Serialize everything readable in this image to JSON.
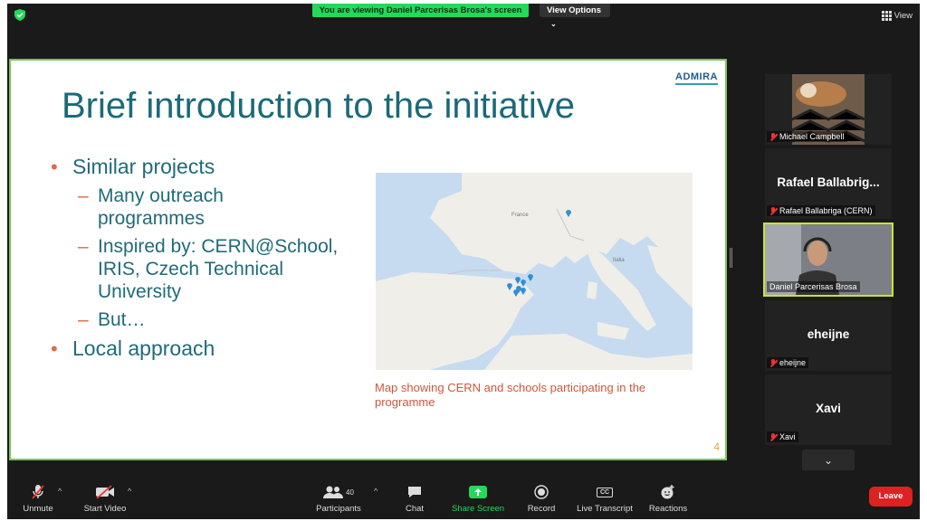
{
  "banner": {
    "text": "You are viewing Daniel Parcerisas Brosa's screen"
  },
  "view_options": {
    "label": "View Options",
    "caret": "⌄"
  },
  "view_button": {
    "label": "View"
  },
  "slide": {
    "logo": "ADMIRA",
    "title": "Brief introduction to the initiative",
    "bullets": [
      {
        "text": "Similar projects",
        "level": 1
      },
      {
        "text": "Many outreach programmes",
        "level": 2
      },
      {
        "text": "Inspired by: CERN@School, IRIS, Czech Technical University",
        "level": 2
      },
      {
        "text": "But…",
        "level": 2
      },
      {
        "text": "Local approach",
        "level": 1
      }
    ],
    "map_caption": "Map showing CERN and schools participating in the programme",
    "page_number": "4",
    "map_labels": {
      "france": "France",
      "italy": "Italia"
    }
  },
  "participants": [
    {
      "name": "Michael Campbell",
      "display": "",
      "muted": true,
      "video": true
    },
    {
      "name": "Rafael Ballabriga (CERN)",
      "display": "Rafael  Ballabrig...",
      "muted": true,
      "video": false
    },
    {
      "name": "Daniel Parcerisas Brosa",
      "display": "",
      "muted": false,
      "video": true,
      "active": true
    },
    {
      "name": "eheijne",
      "display": "eheijne",
      "muted": true,
      "video": false
    },
    {
      "name": "Xavi",
      "display": "Xavi",
      "muted": true,
      "video": false
    }
  ],
  "toolbar": {
    "unmute": "Unmute",
    "start_video": "Start Video",
    "participants": "Participants",
    "participants_count": "40",
    "chat": "Chat",
    "share_screen": "Share Screen",
    "record": "Record",
    "live_transcript": "Live Transcript",
    "cc": "CC",
    "reactions": "Reactions",
    "leave": "Leave"
  },
  "colors": {
    "banner": "#23d959",
    "share": "#23d959",
    "leave": "#dd2222",
    "slide_title": "#1b6a78",
    "accent": "#e06a4a",
    "active_border": "#c9e52b"
  }
}
